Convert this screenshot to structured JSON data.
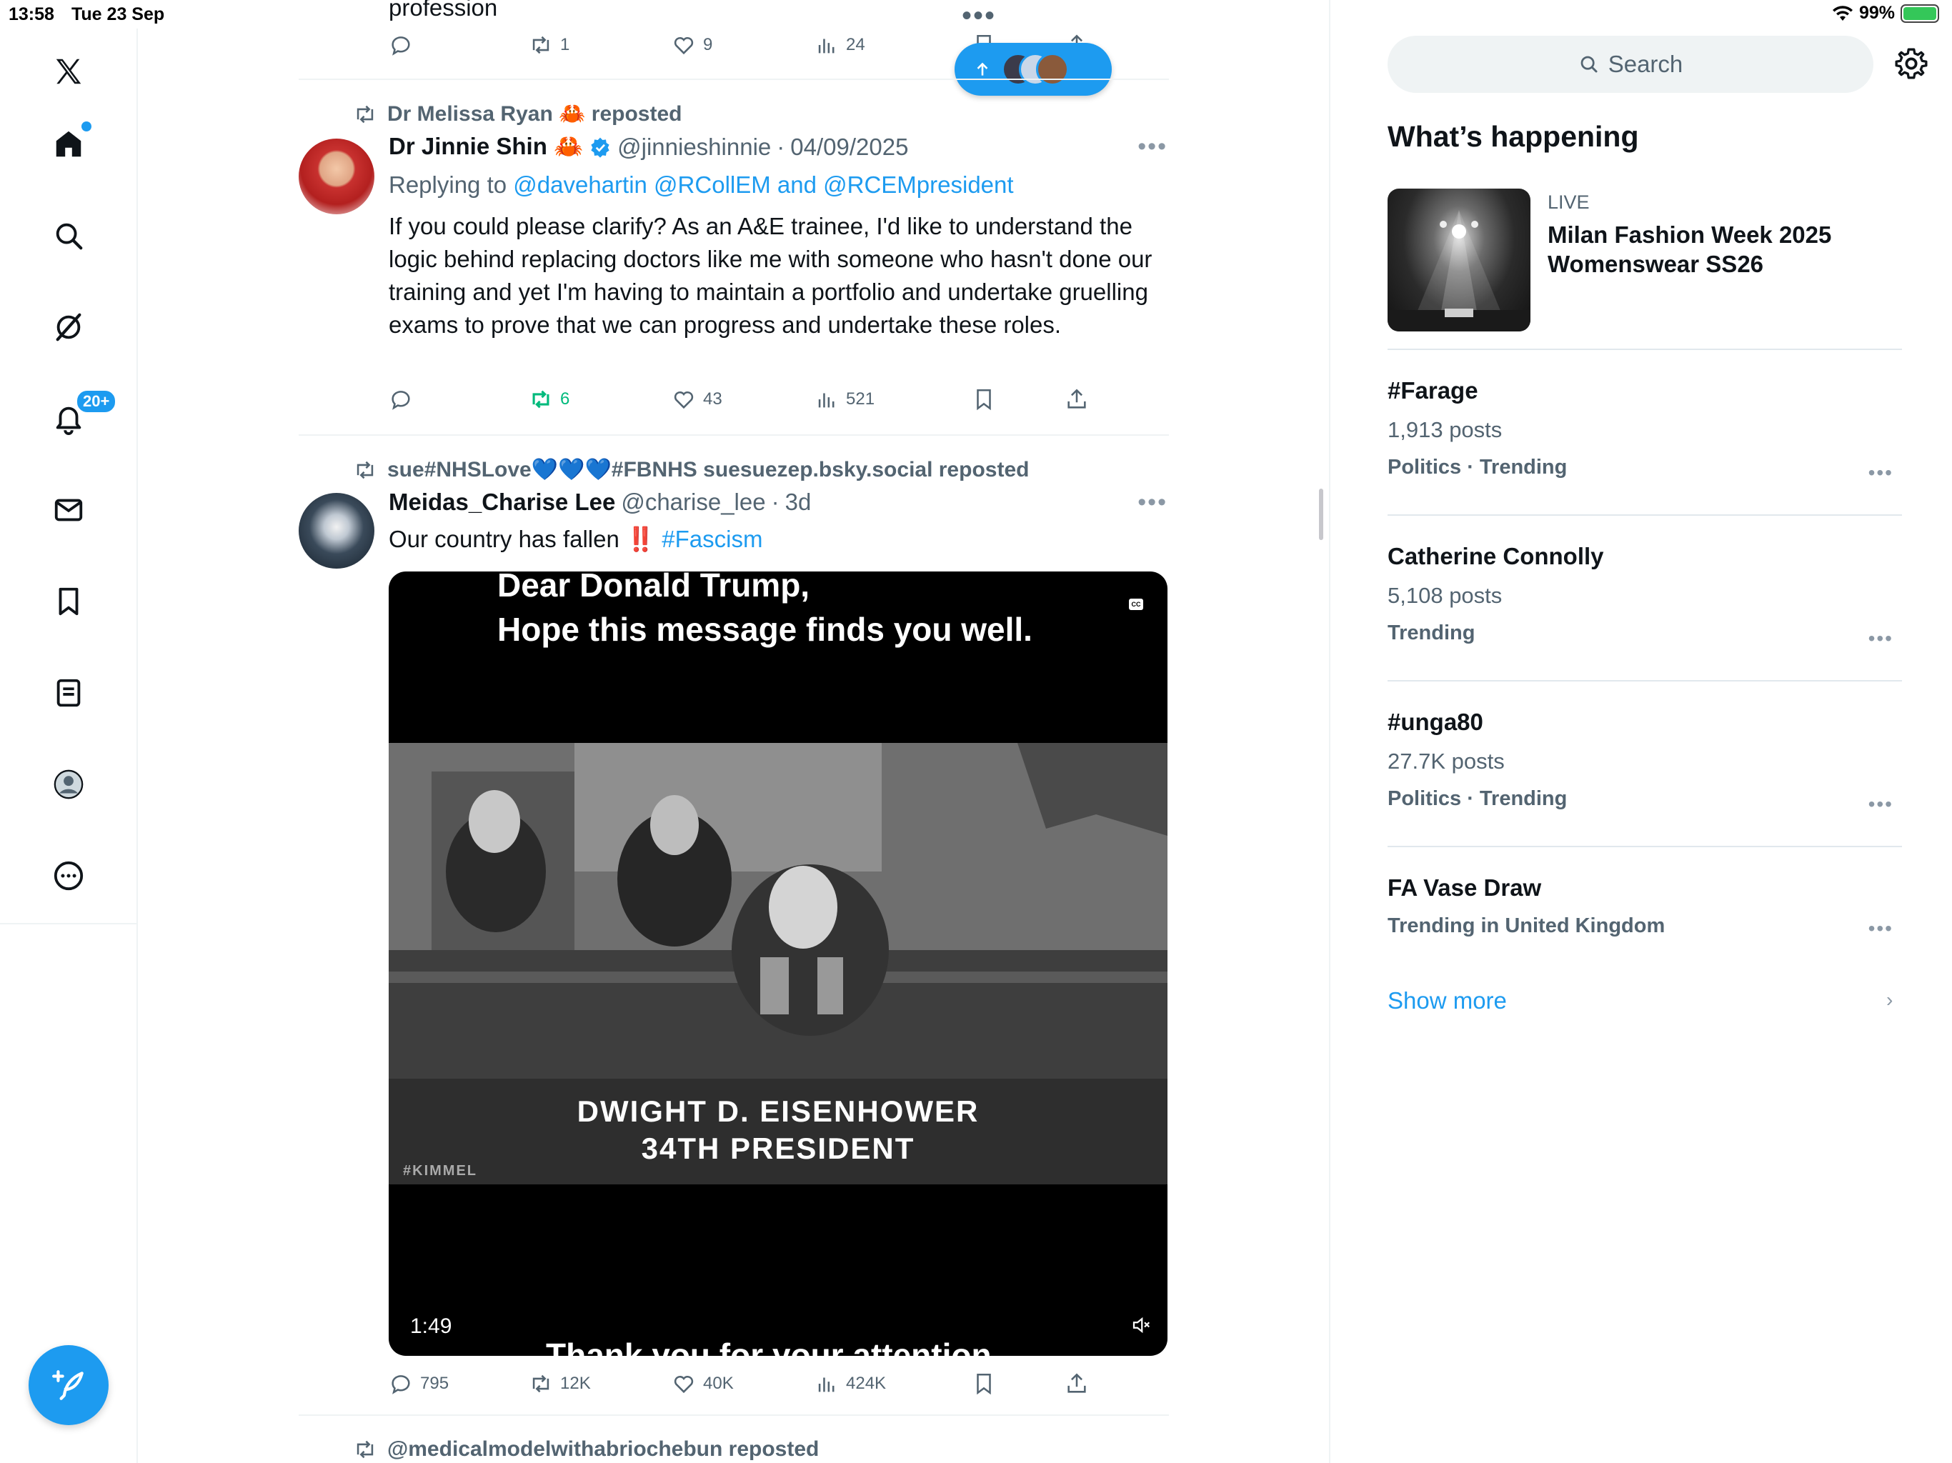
{
  "status_bar": {
    "time": "13:58",
    "date": "Tue 23 Sep",
    "battery": "99%",
    "battery_level": 0.99
  },
  "left_nav": {
    "notifications_badge": "20+",
    "icons": [
      "x-logo-icon",
      "home-icon",
      "search-icon",
      "grok-icon",
      "bell-icon",
      "mail-icon",
      "bookmark-icon",
      "list-icon",
      "profile-icon",
      "more-icon",
      "compose-icon"
    ]
  },
  "feed": {
    "top_tweet": {
      "partial_text": "profession",
      "reply_count": "",
      "repost_count": "1",
      "like_count": "9",
      "view_count": "24"
    },
    "tweet1": {
      "reposted_by": "Dr Melissa Ryan 🦀 reposted",
      "name": "Dr Jinnie Shin 🦀",
      "handle": "@jinnieshinnie",
      "date": "04/09/2025",
      "replying_prefix": "Replying to",
      "replying_to": "@davehartin @RCollEM and @RCEMpresident",
      "text": "If you could please clarify? As an A&E trainee, I'd like to understand the logic behind replacing doctors like me with someone who hasn't done our training and yet I'm having to maintain a portfolio and undertake gruelling exams to prove that we can progress and undertake these roles.",
      "reply_count": "",
      "repost_count": "6",
      "like_count": "43",
      "view_count": "521"
    },
    "tweet2": {
      "reposted_by": "sue#NHSLove💙💙💙#FBNHS suesuezep.bsky.social reposted",
      "name": "Meidas_Charise Lee",
      "handle": "@charise_lee",
      "date": "3d",
      "text": "Our country has fallen ‼️",
      "hashtag": "#Fascism",
      "video": {
        "caption_top_1": "Dear Donald Trump,",
        "caption_top_2": "Hope this message finds you well.",
        "lower_third_1": "DWIGHT D. EISENHOWER",
        "lower_third_2": "34TH PRESIDENT",
        "watermark": "#KIMMEL",
        "duration": "1:49",
        "caption_bottom": "Thank you for your attention",
        "cc_label": "CC"
      },
      "reply_count": "795",
      "repost_count": "12K",
      "like_count": "40K",
      "view_count": "424K"
    },
    "tweet3": {
      "reposted_by": "@medicalmodelwithabriochebun reposted"
    },
    "colors": {
      "accent": "#1d9bf0",
      "repost_active": "#00ba7c",
      "secondary_text": "#536471"
    }
  },
  "right_col": {
    "search_placeholder": "Search",
    "section_title": "What’s happening",
    "live": {
      "label": "LIVE",
      "title": "Milan Fashion Week 2025 Womenswear SS26"
    },
    "trends": [
      {
        "title": "#Farage",
        "count": "1,913 posts",
        "meta": "Politics · Trending"
      },
      {
        "title": "Catherine Connolly",
        "count": "5,108 posts",
        "meta": "Trending"
      },
      {
        "title": "#unga80",
        "count": "27.7K posts",
        "meta": "Politics · Trending"
      },
      {
        "title": "FA Vase Draw",
        "count": "",
        "meta": "Trending in United Kingdom"
      }
    ],
    "show_more": "Show more"
  }
}
